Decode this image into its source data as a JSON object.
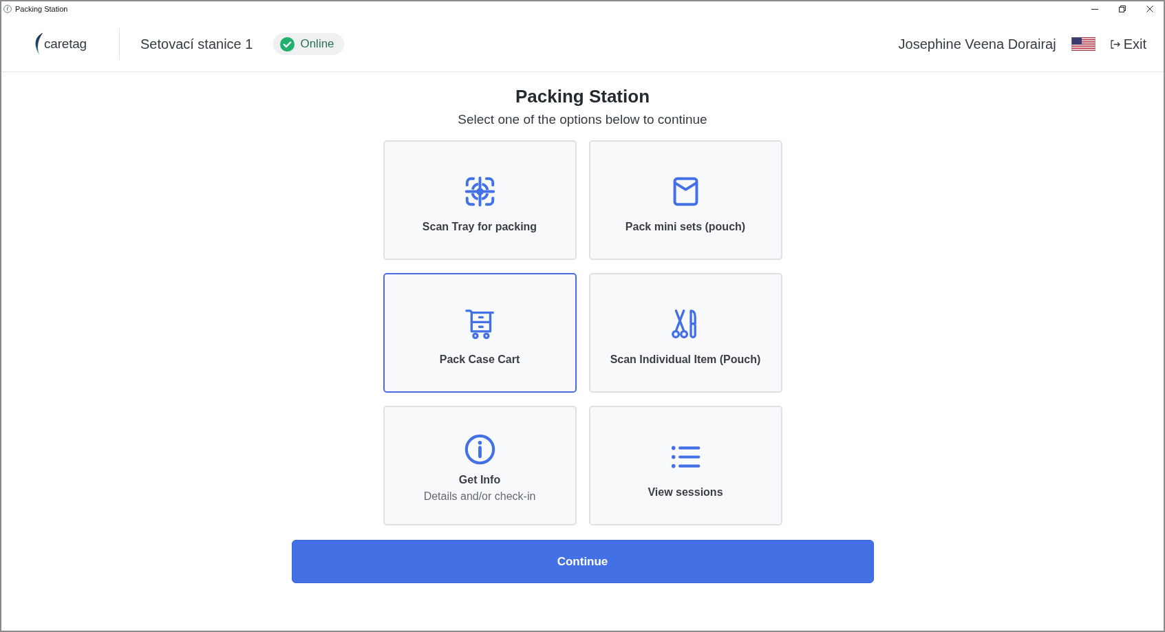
{
  "window": {
    "title": "Packing Station"
  },
  "header": {
    "logo": "caretag",
    "station": "Setovací stanice 1",
    "status": {
      "label": "Online",
      "online": true
    },
    "user": "Josephine Veena Dorairaj",
    "exit": "Exit"
  },
  "page": {
    "title": "Packing Station",
    "subtitle": "Select one of the options below to continue"
  },
  "options": [
    {
      "kind": "scan",
      "label": "Scan Tray for packing",
      "selected": false
    },
    {
      "kind": "pouch",
      "label": "Pack mini sets (pouch)",
      "selected": false
    },
    {
      "kind": "cart",
      "label": "Pack Case Cart",
      "selected": true
    },
    {
      "kind": "instruments",
      "label": "Scan Individual Item (Pouch)",
      "selected": false
    },
    {
      "kind": "info",
      "label": "Get Info",
      "description": "Details and/or check-in",
      "selected": false
    },
    {
      "kind": "list",
      "label": "View sessions",
      "selected": false
    }
  ],
  "continue_button": "Continue"
}
